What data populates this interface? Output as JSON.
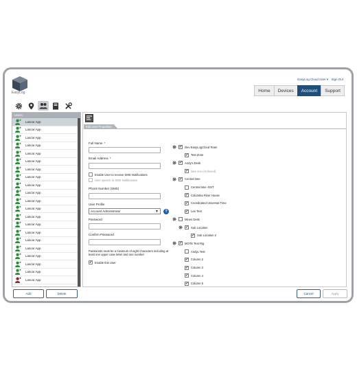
{
  "app": {
    "logo_text": "EasyLog",
    "user_menu": "EasyLog Cloud User ▾",
    "sign_out": "Sign Out"
  },
  "nav": [
    "Home",
    "Devices",
    "Account",
    "Support"
  ],
  "nav_active": "Account",
  "icons": [
    "gear-icon",
    "location-pin-icon",
    "users-icon",
    "notebook-icon",
    "tools-icon"
  ],
  "users": {
    "header": "Users",
    "rows": [
      "Lascar App",
      "Lascar App",
      "Lascar App",
      "Lascar App",
      "Lascar App",
      "Lascar App",
      "Lascar App",
      "Lascar App",
      "Lascar App",
      "Lascar App",
      "Lascar App",
      "Lascar App",
      "Lascar App",
      "Lascar App",
      "Lascar App",
      "Lascar App",
      "Lascar App",
      "Lascar App",
      "Lascar App",
      "Lascar App",
      "Lascar App"
    ],
    "add_label": "Add",
    "delete_label": "Delete"
  },
  "detail": {
    "header": "Edit User Properties",
    "full_name_label": "Full Name",
    "email_label": "Email Address",
    "sms_enable_label": "Enable User to receive SMS Notifications",
    "sms_speech_label": "User speech to SMS Notifications",
    "phone_label": "Phone Number (SMS)",
    "profile_label": "User Profile",
    "profile_value": "Account Administrator",
    "password_label": "Password",
    "confirm_label": "Confirm Password",
    "password_note": "Passwords must be a minimum of eight characters including at least one upper case letter and one number",
    "enable_user_label": "Enable this User",
    "cancel_label": "Cancel",
    "apply_label": "Apply"
  },
  "tree": [
    {
      "label": "Dev-EasyLogCloud Team",
      "checked": true,
      "gear": true,
      "indent": 0
    },
    {
      "label": "Test Zone",
      "checked": true,
      "gear": false,
      "indent": 1
    },
    {
      "label": "Andy's Desk",
      "checked": true,
      "gear": true,
      "indent": 0
    },
    {
      "label": "fake one (Archived)",
      "checked": true,
      "gear": false,
      "indent": 1,
      "disabled": true
    },
    {
      "label": "Central time",
      "checked": true,
      "gear": true,
      "indent": 0
    },
    {
      "label": "Central time -DST",
      "checked": false,
      "gear": false,
      "indent": 1
    },
    {
      "label": "Columbia River House",
      "checked": true,
      "gear": false,
      "indent": 1
    },
    {
      "label": "Coordinated Universal Time",
      "checked": true,
      "gear": false,
      "indent": 1
    },
    {
      "label": "Lee Test",
      "checked": true,
      "gear": false,
      "indent": 1
    },
    {
      "label": "Mines Desk",
      "checked": false,
      "gear": true,
      "indent": 0
    },
    {
      "label": "Sub Location",
      "checked": true,
      "gear": true,
      "indent": 1
    },
    {
      "label": "Sub Location 2",
      "checked": true,
      "gear": false,
      "indent": 2
    },
    {
      "label": "MOTE Test Rig",
      "checked": true,
      "gear": true,
      "indent": 0
    },
    {
      "label": "AndyL Test",
      "checked": false,
      "gear": false,
      "indent": 1
    },
    {
      "label": "Column 2",
      "checked": true,
      "gear": false,
      "indent": 1
    },
    {
      "label": "Column 3",
      "checked": true,
      "gear": false,
      "indent": 1
    },
    {
      "label": "Column 4",
      "checked": true,
      "gear": false,
      "indent": 1
    },
    {
      "label": "Column 5",
      "checked": true,
      "gear": false,
      "indent": 1
    }
  ]
}
